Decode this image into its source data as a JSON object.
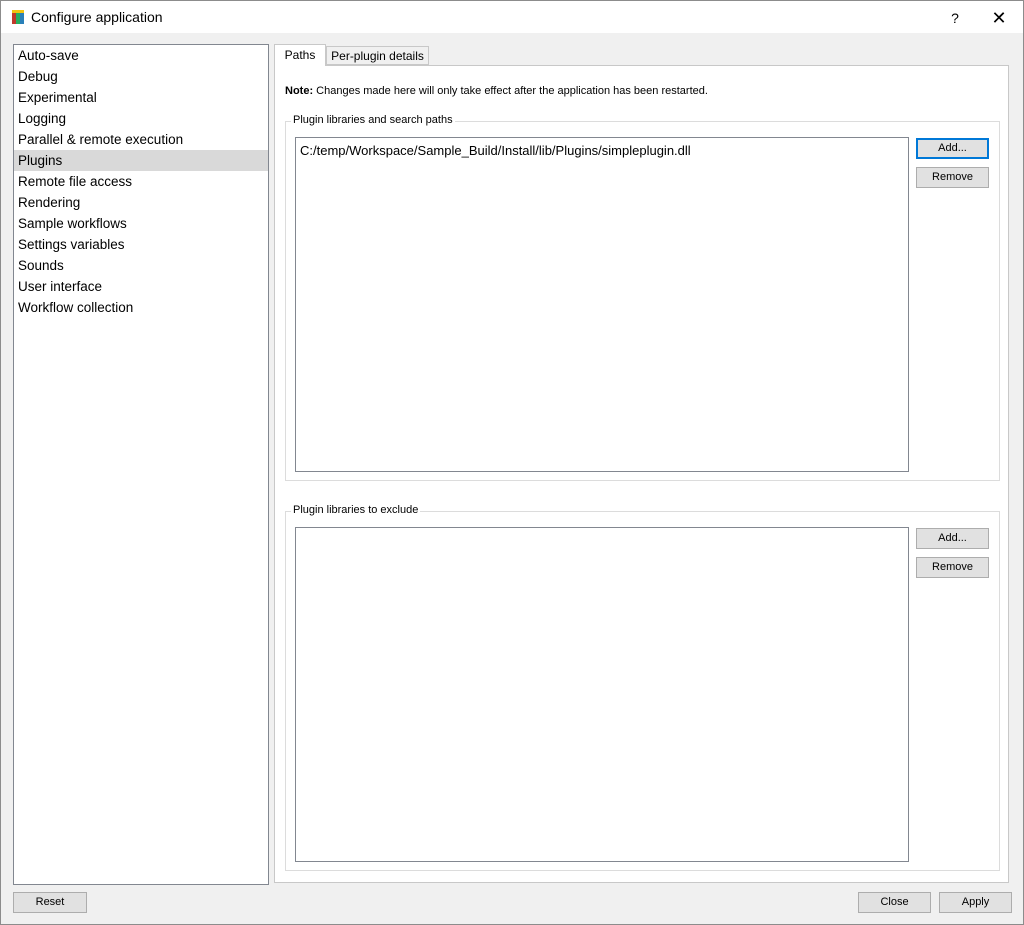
{
  "window": {
    "title": "Configure application",
    "help_glyph": "?",
    "close_glyph": "✕"
  },
  "categories": [
    {
      "label": "Auto-save"
    },
    {
      "label": "Debug"
    },
    {
      "label": "Experimental"
    },
    {
      "label": "Logging"
    },
    {
      "label": "Parallel & remote execution"
    },
    {
      "label": "Plugins",
      "selected": true
    },
    {
      "label": "Remote file access"
    },
    {
      "label": "Rendering"
    },
    {
      "label": "Sample workflows"
    },
    {
      "label": "Settings variables"
    },
    {
      "label": "Sounds"
    },
    {
      "label": "User interface"
    },
    {
      "label": "Workflow collection"
    }
  ],
  "tabs": [
    {
      "label": "Paths",
      "active": true
    },
    {
      "label": "Per-plugin details",
      "active": false
    }
  ],
  "note": {
    "prefix": "Note:",
    "text": " Changes made here will only take effect after the application has been restarted."
  },
  "search_paths": {
    "title": "Plugin libraries and search paths",
    "items": [
      "C:/temp/Workspace/Sample_Build/Install/lib/Plugins/simpleplugin.dll"
    ],
    "add_label": "Add...",
    "remove_label": "Remove"
  },
  "exclude": {
    "title": "Plugin libraries to exclude",
    "items": [],
    "add_label": "Add...",
    "remove_label": "Remove"
  },
  "footer": {
    "reset_label": "Reset",
    "close_label": "Close",
    "apply_label": "Apply"
  },
  "icons": {
    "app": "app-icon",
    "help": "help-icon",
    "close": "close-icon"
  }
}
